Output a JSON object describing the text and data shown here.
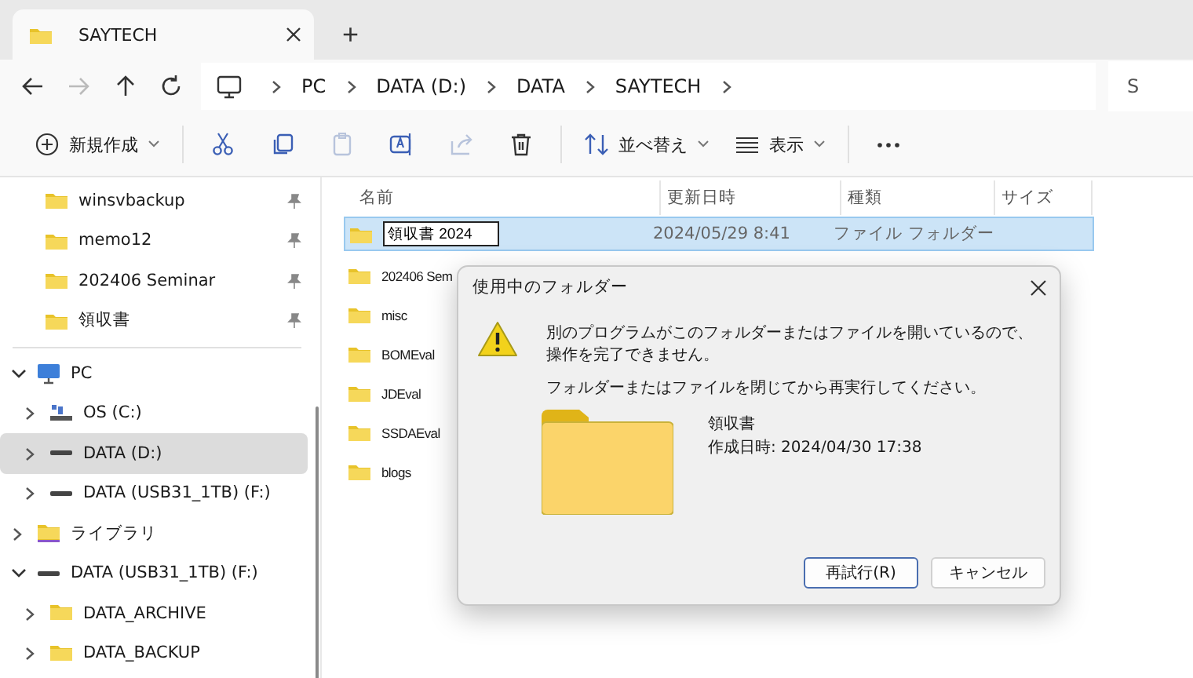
{
  "tab": {
    "title": "SAYTECH",
    "new_tab": "+"
  },
  "nav": [
    {
      "kind": "back",
      "disabled": false
    },
    {
      "kind": "forward",
      "disabled": true
    },
    {
      "kind": "up",
      "disabled": false
    },
    {
      "kind": "refresh",
      "disabled": false
    }
  ],
  "breadcrumb": [
    "PC",
    "DATA (D:)",
    "DATA",
    "SAYTECH"
  ],
  "search": {
    "placeholder": "S"
  },
  "toolbar": [
    {
      "kind": "new",
      "label": "新規作成",
      "dropdown": true,
      "disabled": false
    },
    {
      "kind": "cut",
      "disabled": false
    },
    {
      "kind": "copy",
      "disabled": false
    },
    {
      "kind": "paste",
      "disabled": true
    },
    {
      "kind": "rename",
      "disabled": false
    },
    {
      "kind": "share",
      "disabled": true
    },
    {
      "kind": "delete",
      "disabled": false
    },
    {
      "kind": "sort",
      "label": "並べ替え",
      "dropdown": true,
      "disabled": false
    },
    {
      "kind": "view",
      "label": "表示",
      "dropdown": true,
      "disabled": false
    },
    {
      "kind": "more",
      "disabled": false
    }
  ],
  "pinned": [
    {
      "label": "winsvbackup"
    },
    {
      "label": "memo12"
    },
    {
      "label": "202406 Seminar"
    },
    {
      "label": "領収書"
    }
  ],
  "tree": [
    {
      "label": "PC",
      "kind": "pc",
      "expanded": true,
      "selected": false,
      "children": [
        {
          "label": "OS (C:)",
          "kind": "os-drive",
          "expanded": false,
          "selected": false
        },
        {
          "label": "DATA (D:)",
          "kind": "drive",
          "expanded": false,
          "selected": true
        },
        {
          "label": "DATA (USB31_1TB) (F:)",
          "kind": "drive",
          "expanded": false,
          "selected": false
        }
      ]
    },
    {
      "label": "ライブラリ",
      "kind": "library",
      "expanded": false,
      "selected": false
    },
    {
      "label": "DATA (USB31_1TB) (F:)",
      "kind": "drive",
      "expanded": true,
      "selected": false,
      "children": [
        {
          "label": "DATA_ARCHIVE",
          "kind": "folder",
          "expanded": false,
          "selected": false
        },
        {
          "label": "DATA_BACKUP",
          "kind": "folder",
          "expanded": false,
          "selected": false
        }
      ]
    }
  ],
  "table": {
    "columns": [
      "名前",
      "更新日時",
      "種類",
      "サイズ"
    ],
    "rows": [
      {
        "name": "領収書 2024",
        "renaming": true,
        "selected": true,
        "modified": "2024/05/29 8:41",
        "type": "ファイル フォルダー"
      },
      {
        "name": "202406 Sem",
        "renaming": false,
        "selected": false
      },
      {
        "name": "misc",
        "renaming": false,
        "selected": false
      },
      {
        "name": "BOMEval",
        "renaming": false,
        "selected": false
      },
      {
        "name": "JDEval",
        "renaming": false,
        "selected": false
      },
      {
        "name": "SSDAEval",
        "renaming": false,
        "selected": false
      },
      {
        "name": "blogs",
        "renaming": false,
        "selected": false
      }
    ]
  },
  "dialog": {
    "title": "使用中のフォルダー",
    "messages": [
      "別のプログラムがこのフォルダーまたはファイルを開いているので、操作を完了できません。",
      "フォルダーまたはファイルを閉じてから再実行してください。"
    ],
    "item_name": "領収書",
    "item_created": "作成日時: 2024/04/30 17:38",
    "buttons": [
      {
        "label": "再試行(R)",
        "default": true
      },
      {
        "label": "キャンセル",
        "default": false
      }
    ]
  }
}
